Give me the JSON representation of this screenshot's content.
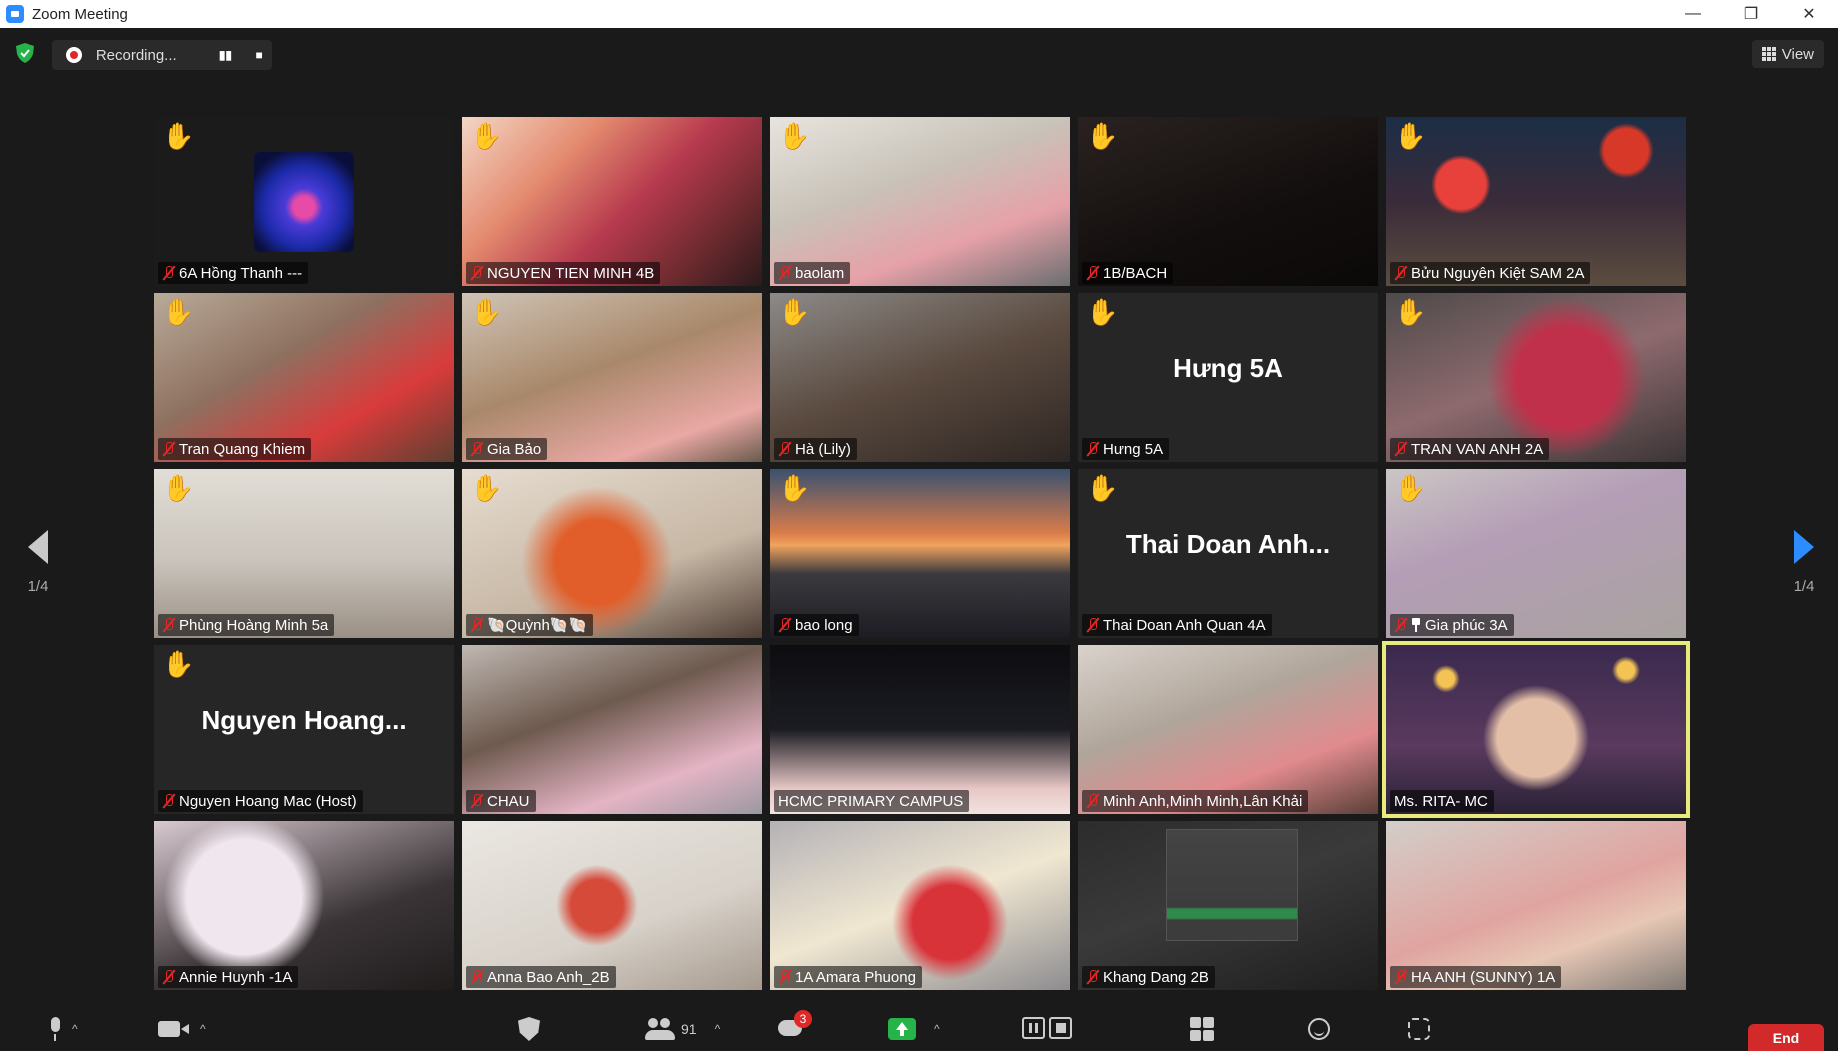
{
  "window": {
    "title": "Zoom Meeting",
    "controls": [
      "—",
      "❐",
      "✕"
    ]
  },
  "recording": {
    "text": "Recording...",
    "pause_symbol": "▮▮",
    "stop_symbol": "■"
  },
  "view_button": {
    "label": "View"
  },
  "pagination": {
    "left": "1/4",
    "right": "1/4"
  },
  "participants": [
    {
      "name": "6A Hồng Thanh ---",
      "muted": true,
      "hand": "raised",
      "video": "jar"
    },
    {
      "name": "NGUYEN TIEN MINH 4B",
      "muted": true,
      "hand": "faded",
      "video": "fish"
    },
    {
      "name": "baolam",
      "muted": true,
      "hand": "faded",
      "video": "girl"
    },
    {
      "name": "1B/BACH",
      "muted": true,
      "hand": "raised",
      "video": "dark1"
    },
    {
      "name": "Bửu Nguyên Kiệt SAM 2A",
      "muted": true,
      "hand": "raised",
      "video": "night"
    },
    {
      "name": "Tran Quang Khiem",
      "muted": true,
      "hand": "raised",
      "video": "boy1"
    },
    {
      "name": "Gia Bảo",
      "muted": true,
      "hand": "faded",
      "video": "boy2"
    },
    {
      "name": "Hà (Lily)",
      "muted": true,
      "hand": "raised",
      "video": "room1"
    },
    {
      "name": "Hưng 5A",
      "muted": true,
      "hand": "raised",
      "video": "",
      "big_name": "Hưng 5A"
    },
    {
      "name": "TRAN VAN ANH 2A",
      "muted": true,
      "hand": "faded",
      "video": "star"
    },
    {
      "name": "Phùng Hoàng Minh 5a",
      "muted": true,
      "hand": "raised",
      "video": "ship"
    },
    {
      "name": "🐚Quỳnh🐚🐚",
      "muted": true,
      "hand": "raised",
      "video": "orange"
    },
    {
      "name": "bao long",
      "muted": true,
      "hand": "faded",
      "video": "sunset"
    },
    {
      "name": "Thai Doan Anh Quan 4A",
      "muted": true,
      "hand": "raised",
      "video": "",
      "big_name": "Thai  Doan  Anh..."
    },
    {
      "name": "Gia phúc 3A",
      "muted": true,
      "pinned": true,
      "hand": "faded",
      "video": "lantern"
    },
    {
      "name": "Nguyen Hoang Mac (Host)",
      "muted": true,
      "hand": "raised",
      "video": "",
      "big_name": "Nguyen  Hoang..."
    },
    {
      "name": "CHAU",
      "muted": true,
      "hand": "",
      "video": "chau"
    },
    {
      "name": "HCMC PRIMARY CAMPUS",
      "muted": false,
      "hand": "",
      "video": "teacher"
    },
    {
      "name": "Minh Anh,Minh Minh,Lân Khải",
      "muted": true,
      "hand": "",
      "video": "kitchen"
    },
    {
      "name": "Ms. RITA- MC",
      "muted": false,
      "hand": "",
      "video": "rita",
      "active_speaker": true
    },
    {
      "name": "Annie Huynh -1A",
      "muted": true,
      "hand": "",
      "video": "kitty"
    },
    {
      "name": "Anna Bao Anh_2B",
      "muted": true,
      "hand": "",
      "video": "frame"
    },
    {
      "name": "1A Amara Phuong",
      "muted": true,
      "hand": "",
      "video": "spider"
    },
    {
      "name": "Khang Dang 2B",
      "muted": true,
      "hand": "",
      "video": "screen"
    },
    {
      "name": "HA ANH (SUNNY) 1A",
      "muted": true,
      "hand": "",
      "video": "pinkdress"
    }
  ],
  "toolbar": {
    "participants_count": "91",
    "chat_badge": "3",
    "end_label": "End"
  },
  "colors": {
    "active_speaker_border": "#e8ea7c",
    "hand": "#f5c21b",
    "end_button": "#d22a2a",
    "share_button": "#25b34a",
    "next_arrow": "#2d8cff"
  }
}
